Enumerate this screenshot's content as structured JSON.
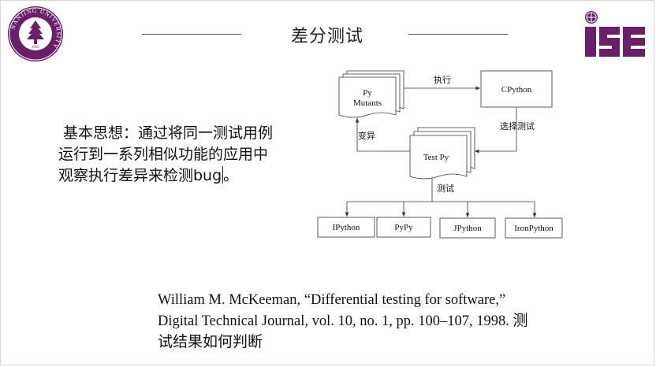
{
  "slide": {
    "title": "差分测试",
    "idea_lines": [
      "基本思想：通过将同一测试用例",
      "运行到一系列相似功能的应用中",
      "观察执行差异来检测bug"
    ],
    "idea_end": "。",
    "reference": "William M. McKeeman, “Differential testing for software,” Digital Technical Journal, vol. 10, no. 1, pp. 100–107, 1998.",
    "question": "测试结果如何判断"
  },
  "logos": {
    "left_ring_text": "NANJING UNIVERSITY",
    "left_year": "1902",
    "right_text": "ISE",
    "brand_color": "#6b1f6b"
  },
  "diagram": {
    "nodes": {
      "mutants_line1": "Py",
      "mutants_line2": "Mutants",
      "cpython": "CPython",
      "testpy": "Test Py",
      "targets": [
        "IPython",
        "PyPy",
        "JPython",
        "IronPython"
      ]
    },
    "edges": {
      "execute": "执行",
      "select": "选择测试",
      "mutate": "变异",
      "test": "测试"
    }
  }
}
